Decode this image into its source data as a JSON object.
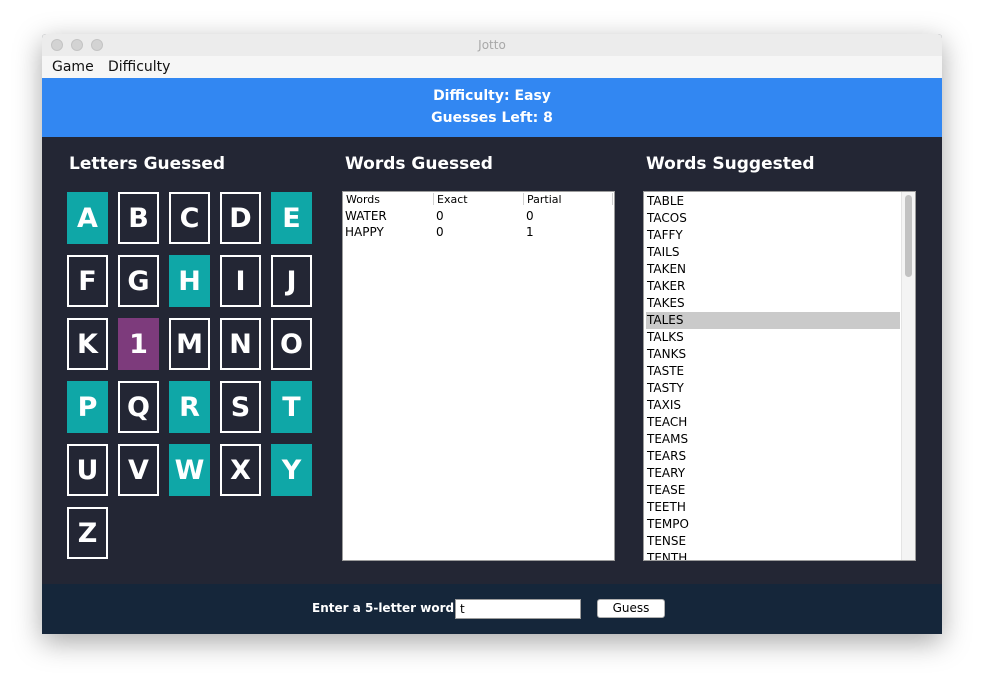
{
  "window": {
    "title": "Jotto"
  },
  "menu": [
    "Game",
    "Difficulty"
  ],
  "status": {
    "difficulty": "Difficulty: Easy",
    "guesses_left": "Guesses Left: 8"
  },
  "letters_panel": {
    "title": "Letters Guessed",
    "tiles": [
      {
        "label": "A",
        "state": "teal"
      },
      {
        "label": "B",
        "state": "plain"
      },
      {
        "label": "C",
        "state": "plain"
      },
      {
        "label": "D",
        "state": "plain"
      },
      {
        "label": "E",
        "state": "teal"
      },
      {
        "label": "F",
        "state": "plain"
      },
      {
        "label": "G",
        "state": "plain"
      },
      {
        "label": "H",
        "state": "teal"
      },
      {
        "label": "I",
        "state": "plain"
      },
      {
        "label": "J",
        "state": "plain"
      },
      {
        "label": "K",
        "state": "plain"
      },
      {
        "label": "1",
        "state": "purple"
      },
      {
        "label": "M",
        "state": "plain"
      },
      {
        "label": "N",
        "state": "plain"
      },
      {
        "label": "O",
        "state": "plain"
      },
      {
        "label": "P",
        "state": "teal"
      },
      {
        "label": "Q",
        "state": "plain"
      },
      {
        "label": "R",
        "state": "teal"
      },
      {
        "label": "S",
        "state": "plain"
      },
      {
        "label": "T",
        "state": "teal"
      },
      {
        "label": "U",
        "state": "plain"
      },
      {
        "label": "V",
        "state": "plain"
      },
      {
        "label": "W",
        "state": "teal"
      },
      {
        "label": "X",
        "state": "plain"
      },
      {
        "label": "Y",
        "state": "teal"
      },
      {
        "label": "Z",
        "state": "plain"
      }
    ]
  },
  "words_panel": {
    "title": "Words Guessed",
    "columns": [
      "Words",
      "Exact",
      "Partial"
    ],
    "rows": [
      [
        "WATER",
        "0",
        "0"
      ],
      [
        "HAPPY",
        "0",
        "1"
      ]
    ]
  },
  "suggestions_panel": {
    "title": "Words Suggested",
    "selected": "TALES",
    "items": [
      "TABLE",
      "TACOS",
      "TAFFY",
      "TAILS",
      "TAKEN",
      "TAKER",
      "TAKES",
      "TALES",
      "TALKS",
      "TANKS",
      "TASTE",
      "TASTY",
      "TAXIS",
      "TEACH",
      "TEAMS",
      "TEARS",
      "TEARY",
      "TEASE",
      "TEETH",
      "TEMPO",
      "TENSE",
      "TENTH"
    ]
  },
  "entry": {
    "prompt": "Enter a 5-letter word:",
    "value": "t",
    "button": "Guess"
  },
  "colors": {
    "teal": "#0fa7a7",
    "purple": "#7d3b7c",
    "banner": "#3287f2",
    "panel_bg": "#232634",
    "bottom_bg": "#15263a"
  }
}
